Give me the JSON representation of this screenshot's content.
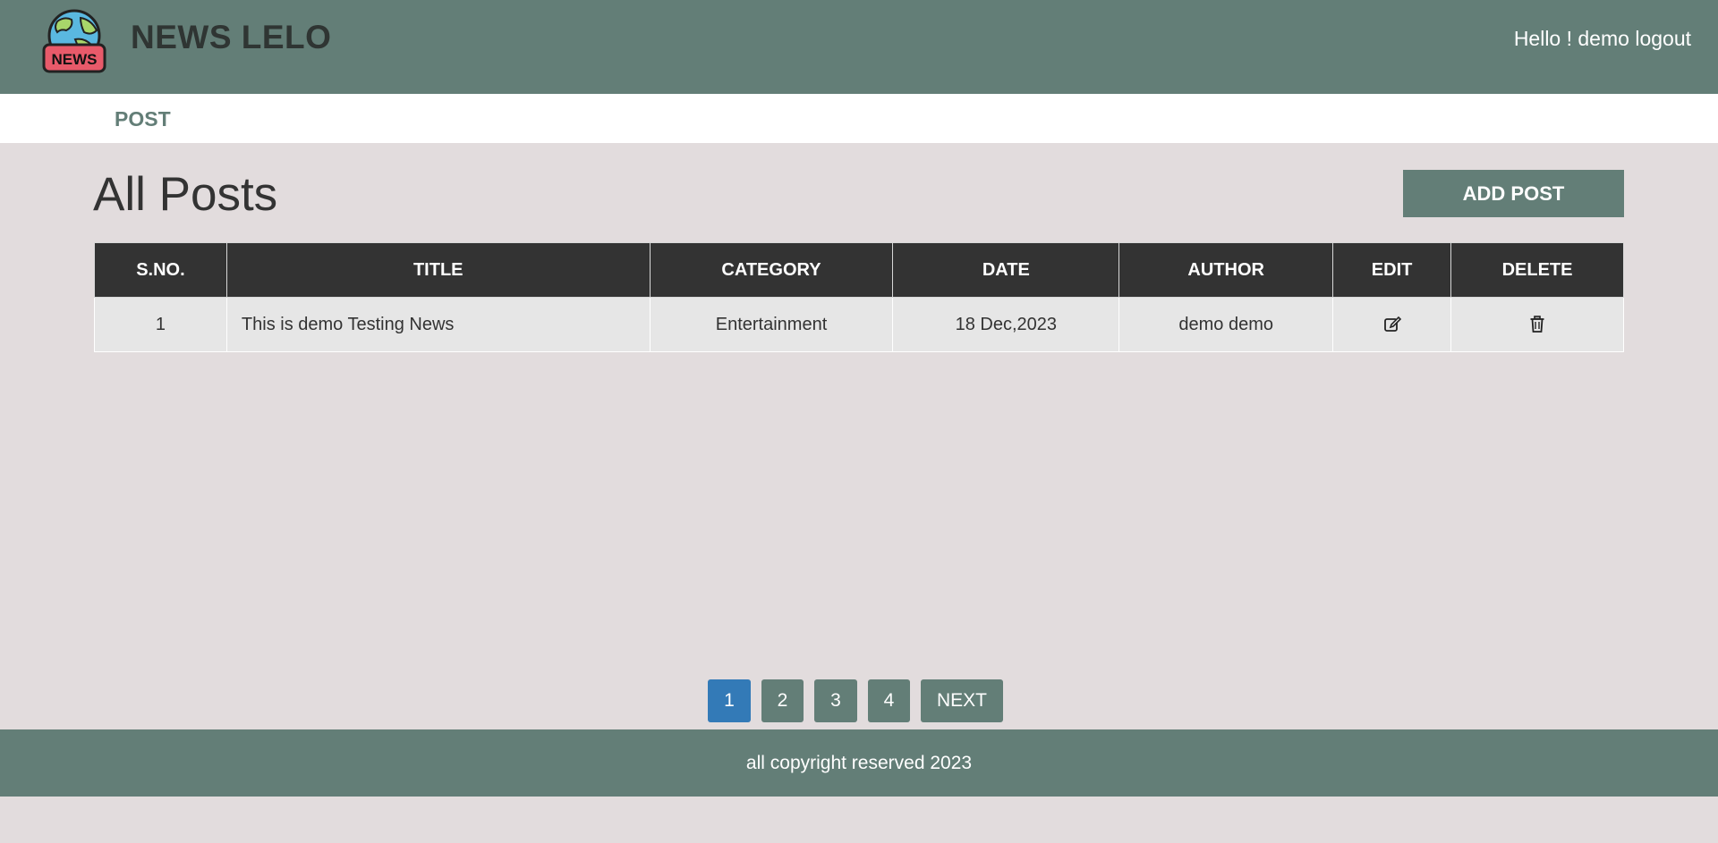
{
  "header": {
    "brand": "NEWS LELO",
    "logo_text": "NEWS",
    "greeting": "Hello ! demo",
    "logout_label": "logout"
  },
  "nav": {
    "items": [
      {
        "label": "POST"
      }
    ]
  },
  "main": {
    "title": "All Posts",
    "add_post_label": "ADD POST"
  },
  "table": {
    "columns": [
      "S.NO.",
      "TITLE",
      "CATEGORY",
      "DATE",
      "AUTHOR",
      "EDIT",
      "DELETE"
    ],
    "rows": [
      {
        "sno": "1",
        "title": "This is demo Testing News",
        "category": "Entertainment",
        "date": "18 Dec,2023",
        "author": "demo demo",
        "edit_icon": "edit-icon",
        "delete_icon": "trash-icon"
      }
    ]
  },
  "pagination": {
    "pages": [
      "1",
      "2",
      "3",
      "4"
    ],
    "active": "1",
    "next_label": "NEXT"
  },
  "footer": {
    "text": "all copyright reserved 2023"
  },
  "colors": {
    "header_bg": "#637e77",
    "page_bg": "#e2dcdd",
    "table_header_bg": "#333333",
    "active_page": "#337ab7"
  }
}
